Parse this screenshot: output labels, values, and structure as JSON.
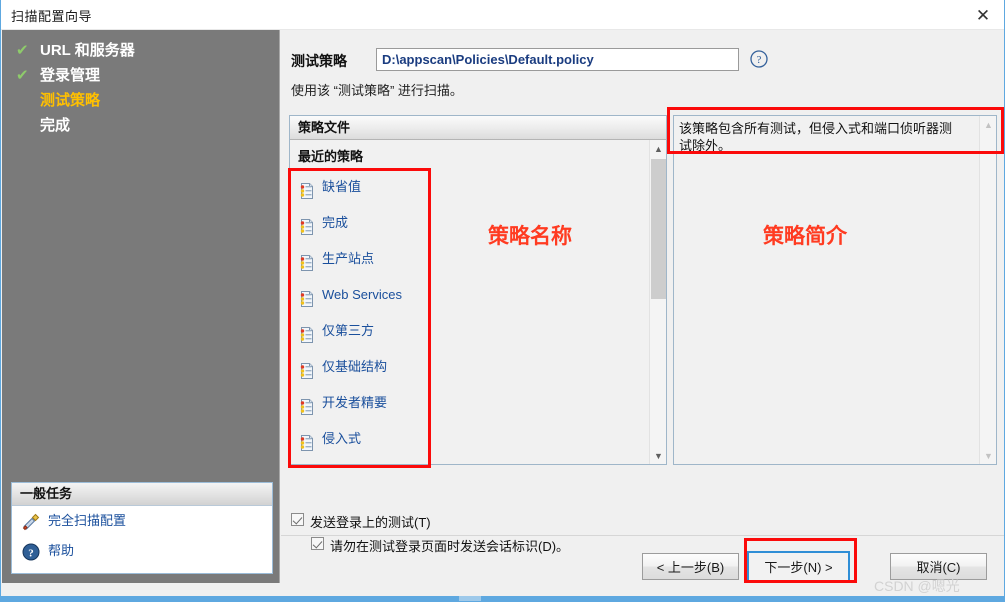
{
  "window": {
    "title": "扫描配置向导",
    "close_label": "✕"
  },
  "sidebar": {
    "steps": [
      {
        "label": "URL 和服务器",
        "state": "done",
        "tick": "✔"
      },
      {
        "label": "登录管理",
        "state": "done",
        "tick": "✔"
      },
      {
        "label": "测试策略",
        "state": "current",
        "tick": ""
      },
      {
        "label": "完成",
        "state": "todo",
        "tick": ""
      }
    ],
    "tasks": {
      "header": "一般任务",
      "items": [
        {
          "label": "完全扫描配置",
          "icon": "tools-icon"
        },
        {
          "label": "帮助",
          "icon": "help-icon"
        }
      ]
    }
  },
  "main": {
    "policy_field": {
      "label": "测试策略",
      "value": "D:\\appscan\\Policies\\Default.policy",
      "placeholder": "D:\\appscan\\Policies\\Default.policy",
      "help_icon": "question-circle-icon"
    },
    "hint": "使用该 “测试策略” 进行扫描。",
    "list": {
      "header": "策略文件",
      "group_label": "最近的策略",
      "items": [
        {
          "label": "缺省值"
        },
        {
          "label": "完成"
        },
        {
          "label": "生产站点"
        },
        {
          "label": "Web Services"
        },
        {
          "label": "仅第三方"
        },
        {
          "label": "仅基础结构"
        },
        {
          "label": "开发者精要"
        },
        {
          "label": "侵入式"
        }
      ]
    },
    "description": {
      "text": "该策略包含所有测试，但侵入式和端口侦听器测试除外。"
    },
    "checkboxes": [
      {
        "label": "发送登录上的测试(T)",
        "checked": true,
        "accesskey": "T"
      },
      {
        "label": "请勿在测试登录页面时发送会话标识(D)。",
        "checked": true,
        "accesskey": "D"
      }
    ],
    "buttons": {
      "back": "< 上一步(B)",
      "next": "下一步(N) >",
      "cancel": "取消(C)"
    }
  },
  "annotations": [
    {
      "id": "policy-name",
      "text": "策略名称"
    },
    {
      "id": "policy-summary",
      "text": "策略简介"
    }
  ],
  "watermark": "CSDN @嗯光",
  "colors": {
    "sidebar_bg": "#7a7a7a",
    "current_step": "#ffc000",
    "tick_green": "#8ecb6b",
    "link_blue": "#1a4f9c",
    "annotation_red": "#ff3b21",
    "redbox": "#fb0a0a",
    "primary_border": "#2f8ed6",
    "window_border": "#5ea8e0"
  }
}
